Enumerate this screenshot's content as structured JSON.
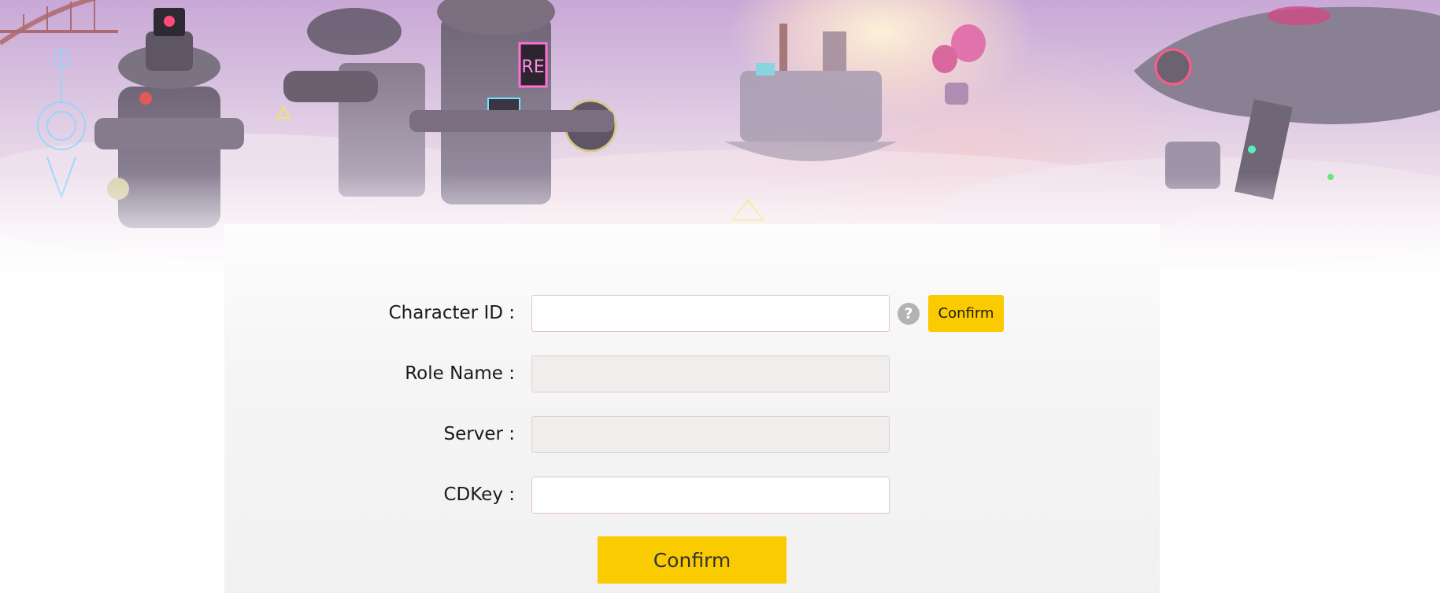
{
  "banner": {
    "sign_text": "RE"
  },
  "form": {
    "character_id": {
      "label": "Character ID :",
      "value": "",
      "help_icon_glyph": "?",
      "confirm_label": "Confirm"
    },
    "role_name": {
      "label": "Role Name :",
      "value": ""
    },
    "server": {
      "label": "Server :",
      "value": ""
    },
    "cdkey": {
      "label": "CDKey :",
      "value": ""
    },
    "submit_label": "Confirm"
  },
  "colors": {
    "accent": "#f9cb00",
    "field_border": "#e2c5c5",
    "disabled_field": "#efeeed",
    "help_icon": "#b3b3b3"
  },
  "icons": {
    "help": "question-mark-icon"
  }
}
